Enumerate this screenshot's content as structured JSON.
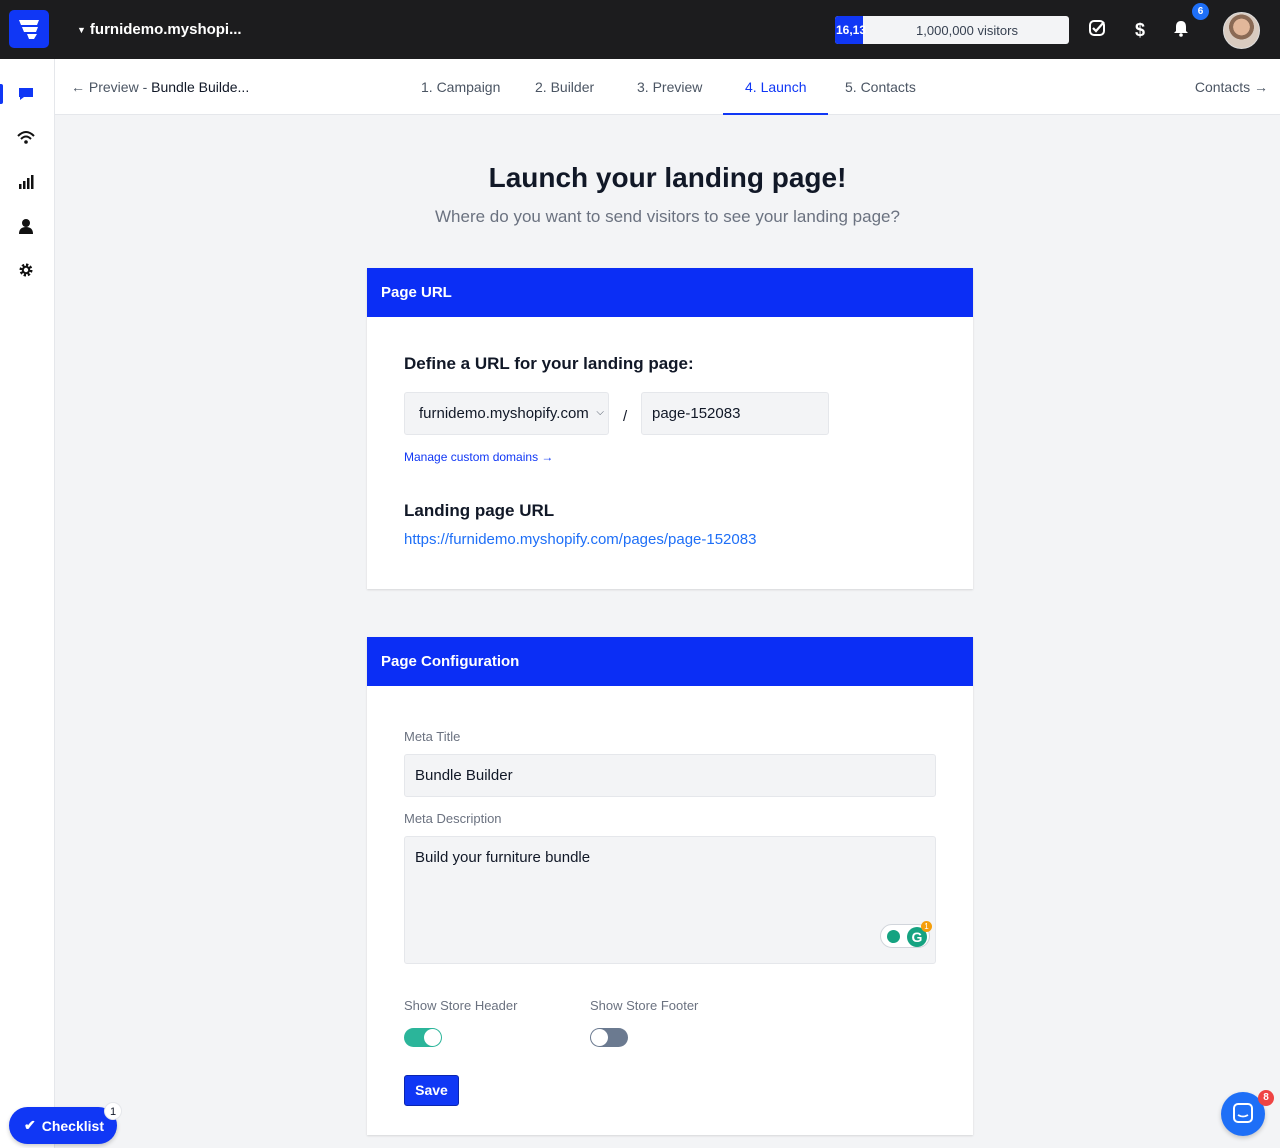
{
  "topbar": {
    "store_name": "furnidemo.myshopi...",
    "visitor_count": "16,13",
    "visitor_limit_label": "1,000,000 visitors",
    "visitor_progress_fraction": 0.12,
    "notifications_count": "6"
  },
  "sidebar": {
    "items": [
      {
        "icon": "chat-icon",
        "active": true
      },
      {
        "icon": "wifi-icon",
        "active": false
      },
      {
        "icon": "bar-chart-icon",
        "active": false
      },
      {
        "icon": "user-icon",
        "active": false
      },
      {
        "icon": "gear-icon",
        "active": false
      }
    ]
  },
  "subnav": {
    "back_prefix": "Preview -",
    "back_title": "Bundle Builde...",
    "tabs": [
      {
        "label": "1. Campaign",
        "active": false
      },
      {
        "label": "2. Builder",
        "active": false
      },
      {
        "label": "3. Preview",
        "active": false
      },
      {
        "label": "4. Launch",
        "active": true
      },
      {
        "label": "5. Contacts",
        "active": false
      }
    ],
    "next_label": "Contacts"
  },
  "main": {
    "title": "Launch your landing page!",
    "subtitle": "Where do you want to send visitors to see your landing page?"
  },
  "page_url": {
    "header": "Page URL",
    "define_label": "Define a URL for your landing page:",
    "domain_value": "furnidemo.myshopify.com",
    "separator": "/",
    "slug_value": "page-152083",
    "manage_link": "Manage custom domains →",
    "landing_label": "Landing page URL",
    "landing_url": "https://furnidemo.myshopify.com/pages/page-152083"
  },
  "page_config": {
    "header": "Page Configuration",
    "meta_title_label": "Meta Title",
    "meta_title_value": "Bundle Builder",
    "meta_desc_label": "Meta Description",
    "meta_desc_value": "Build your furniture bundle",
    "grammarly_count": "1",
    "show_header_label": "Show Store Header",
    "show_header_on": true,
    "show_footer_label": "Show Store Footer",
    "show_footer_on": false,
    "save_label": "Save"
  },
  "checklist": {
    "label": "Checklist",
    "count": "1"
  },
  "chat": {
    "count": "8"
  },
  "colors": {
    "brand_blue": "#1037f5",
    "toggle_on": "#2bb59a",
    "toggle_off": "#6b7a90"
  }
}
